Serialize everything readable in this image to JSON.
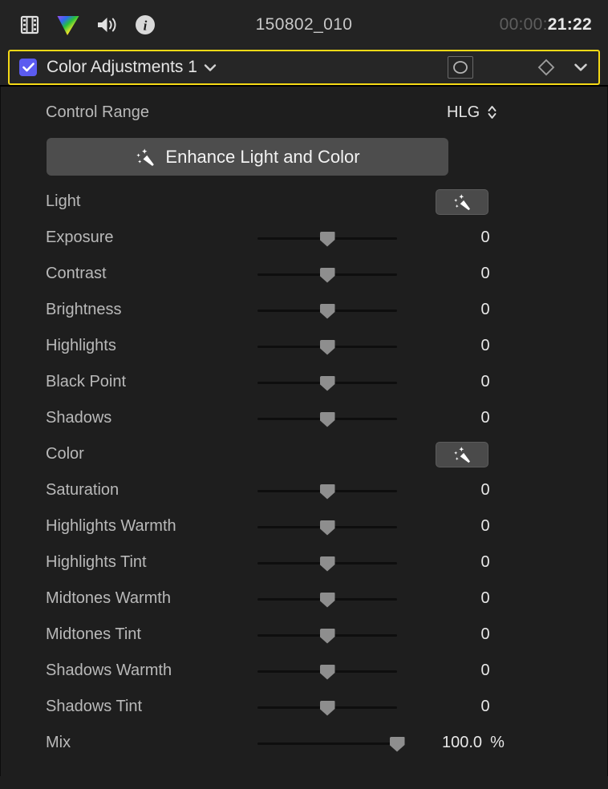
{
  "toolbar": {
    "icons": [
      {
        "name": "video-icon",
        "label": "Video"
      },
      {
        "name": "color-icon",
        "label": "Color"
      },
      {
        "name": "audio-icon",
        "label": "Audio"
      },
      {
        "name": "info-icon",
        "label": "Info"
      }
    ],
    "clip_title": "150802_010",
    "timecode_dim": "00:00:",
    "timecode_bright": "21:22"
  },
  "effect_header": {
    "enabled": true,
    "name": "Color Adjustments 1",
    "mask_icon": "mask-shape-icon",
    "keyframe_icon": "keyframe-diamond-icon",
    "collapse_icon": "chevron-down-icon",
    "accent_color": "#f5d916",
    "checkbox_color": "#5b5bf0"
  },
  "controls": {
    "control_range_label": "Control Range",
    "control_range_value": "HLG",
    "enhance_button_label": "Enhance Light and Color"
  },
  "sections": {
    "light_label": "Light",
    "color_label": "Color"
  },
  "parameters": {
    "light": [
      {
        "label": "Exposure",
        "value": "0",
        "pos": 50
      },
      {
        "label": "Contrast",
        "value": "0",
        "pos": 50
      },
      {
        "label": "Brightness",
        "value": "0",
        "pos": 50
      },
      {
        "label": "Highlights",
        "value": "0",
        "pos": 50
      },
      {
        "label": "Black Point",
        "value": "0",
        "pos": 50
      },
      {
        "label": "Shadows",
        "value": "0",
        "pos": 50
      }
    ],
    "color": [
      {
        "label": "Saturation",
        "value": "0",
        "pos": 50
      },
      {
        "label": "Highlights Warmth",
        "value": "0",
        "pos": 50
      },
      {
        "label": "Highlights Tint",
        "value": "0",
        "pos": 50
      },
      {
        "label": "Midtones Warmth",
        "value": "0",
        "pos": 50
      },
      {
        "label": "Midtones Tint",
        "value": "0",
        "pos": 50
      },
      {
        "label": "Shadows Warmth",
        "value": "0",
        "pos": 50
      },
      {
        "label": "Shadows Tint",
        "value": "0",
        "pos": 50
      }
    ],
    "mix": {
      "label": "Mix",
      "value": "100.0",
      "unit": "%",
      "pos": 100
    }
  }
}
